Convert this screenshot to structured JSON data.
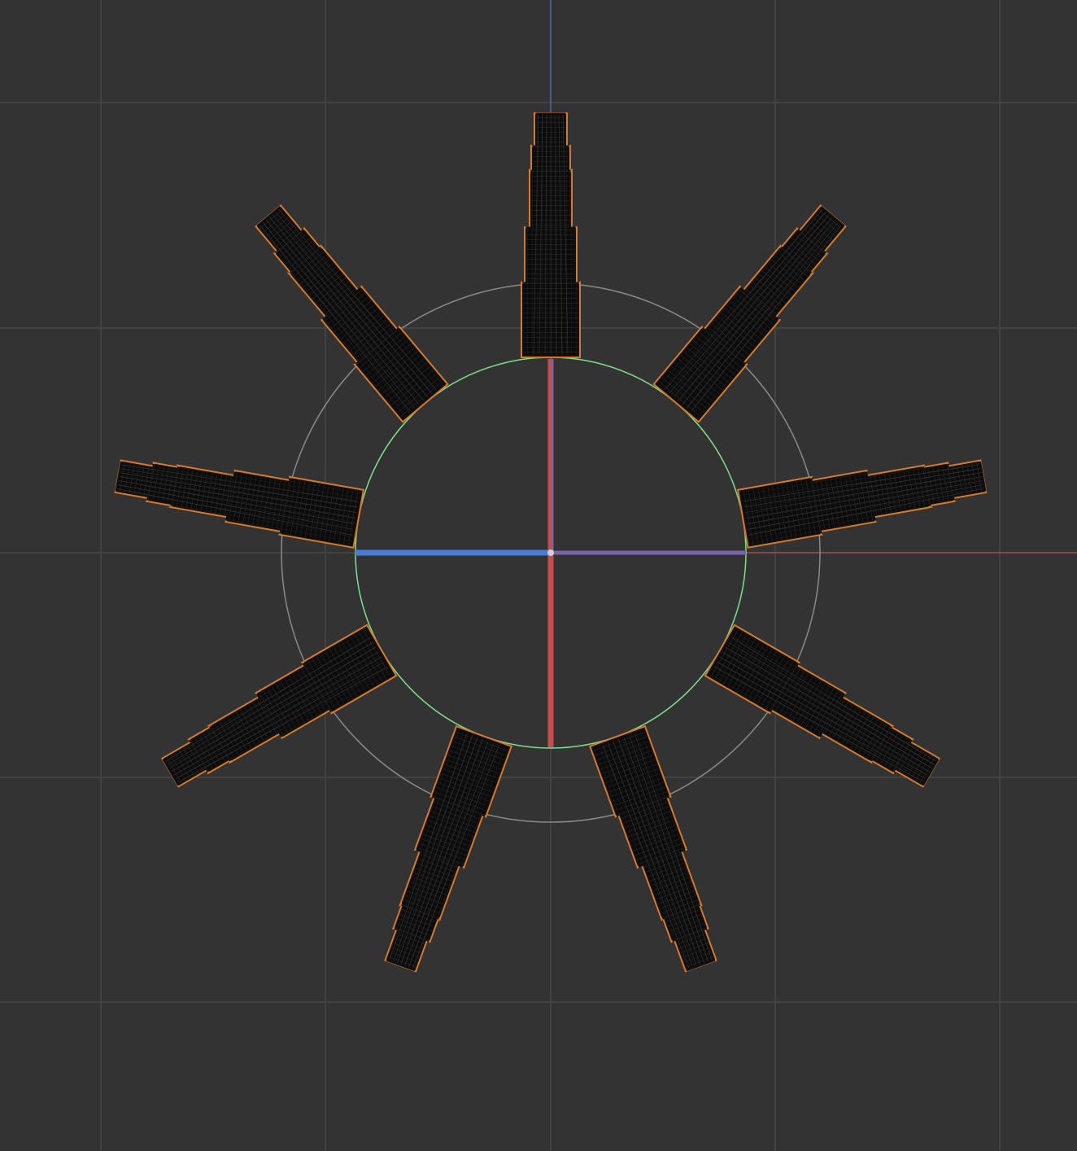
{
  "viewport": {
    "view": "top",
    "background_color": "#333333",
    "grid": {
      "visible": true,
      "line_color": "#474747"
    },
    "axes": {
      "x_axis_color": "#c0504d",
      "y_axis_color": "#4a79d6"
    }
  },
  "scene": {
    "object_count": 9,
    "array_type": "radial",
    "rotation_step_deg": 40,
    "selection_outline_color": "#d67a2e",
    "mesh_fill_color": "#0b0b0b",
    "wire_color": "#3a3a3a",
    "inner_circle_color": "#7fe08a",
    "outer_circle_color": "#8a8a8a"
  },
  "gizmo": {
    "x_handle_color": "#c94b4b",
    "y_handle_color": "#4a79d6",
    "visible": true
  }
}
